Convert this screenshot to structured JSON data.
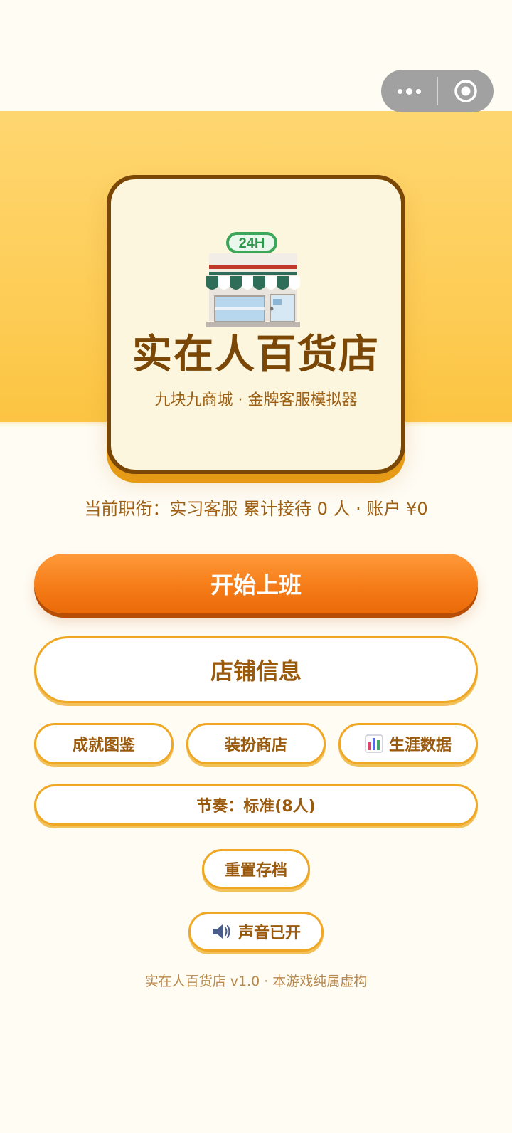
{
  "capsule": {
    "more_icon": "more-dots-icon",
    "close_icon": "target-circle-icon"
  },
  "hero": {
    "icon": "convenience-store-icon",
    "sign_text": "24H",
    "title": "实在人百货店",
    "subtitle": "九块九商城 · 金牌客服模拟器"
  },
  "status": {
    "text": "当前职衔：实习客服 累计接待 0 人 · 账户 ¥0"
  },
  "buttons": {
    "start": "开始上班",
    "shop_info": "店铺信息",
    "achievements": "成就图鉴",
    "dress_shop": "装扮商店",
    "career_icon": "bar-chart-icon",
    "career": "生涯数据",
    "pace": "节奏：标准(8人)",
    "reset": "重置存档",
    "sound_icon": "speaker-icon",
    "sound": "声音已开"
  },
  "footer": {
    "text": "实在人百货店 v1.0 · 本游戏纯属虚构"
  },
  "colors": {
    "band": "#FDCB52",
    "card_border": "#7A4706",
    "card_bg": "#FDF6DE",
    "primary": "#F57C18",
    "outline": "#EFA724",
    "text_brown": "#9C5F13",
    "background": "#FFFCF4"
  }
}
